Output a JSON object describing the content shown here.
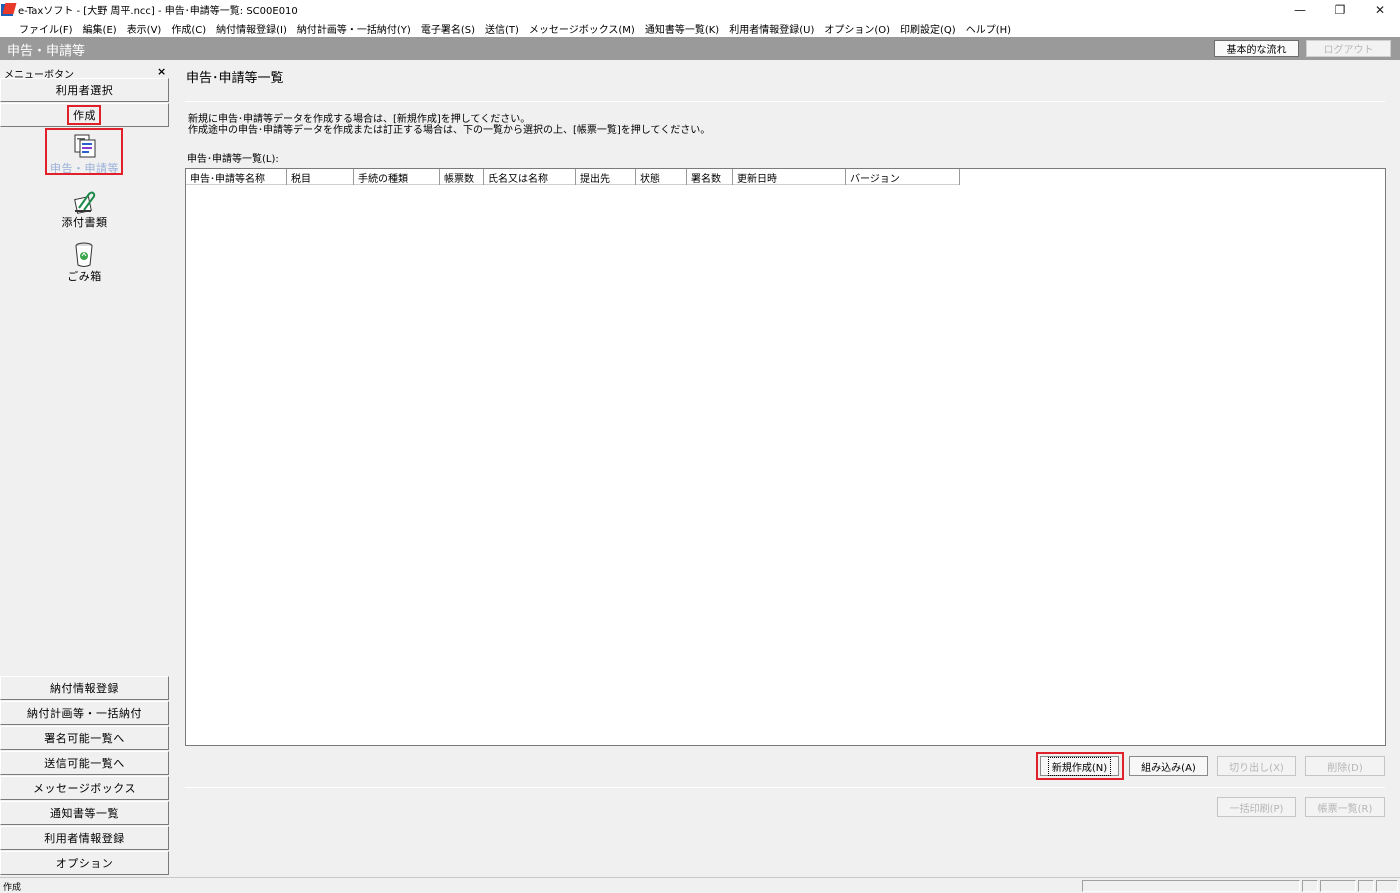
{
  "window": {
    "title": "e-Taxソフト - [大野 周平.ncc] - 申告･申請等一覧: SC00E010",
    "minimize": "—",
    "maximize": "❐",
    "close": "✕"
  },
  "menubar": [
    "ファイル(F)",
    "編集(E)",
    "表示(V)",
    "作成(C)",
    "納付情報登録(I)",
    "納付計画等・一括納付(Y)",
    "電子署名(S)",
    "送信(T)",
    "メッセージボックス(M)",
    "通知書等一覧(K)",
    "利用者情報登録(U)",
    "オプション(O)",
    "印刷設定(Q)",
    "ヘルプ(H)"
  ],
  "header": {
    "title": "申告・申請等",
    "basic_flow_button": "基本的な流れ",
    "logout_button": "ログアウト"
  },
  "left_menu": {
    "caption": "メニューボタン",
    "close": "×",
    "user_select": "利用者選択",
    "create": "作成",
    "sub_items": {
      "declaration": "申告・申請等",
      "attachments": "添付書類",
      "trash": "ごみ箱"
    },
    "bottom_buttons": [
      "納付情報登録",
      "納付計画等・一括納付",
      "署名可能一覧へ",
      "送信可能一覧へ",
      "メッセージボックス",
      "通知書等一覧",
      "利用者情報登録",
      "オプション"
    ]
  },
  "main": {
    "title": "申告･申請等一覧",
    "instruction_line1": "新規に申告･申請等データを作成する場合は、[新規作成]を押してください。",
    "instruction_line2": "作成途中の申告･申請等データを作成または訂正する場合は、下の一覧から選択の上、[帳票一覧]を押してください。",
    "list_label": "申告･申請等一覧(L):",
    "columns": [
      "申告･申請等名称",
      "税目",
      "手続の種類",
      "帳票数",
      "氏名又は名称",
      "提出先",
      "状態",
      "署名数",
      "更新日時",
      "バージョン"
    ],
    "rows": [],
    "buttons": {
      "new": "新規作成(N)",
      "import": "組み込み(A)",
      "export": "切り出し(X)",
      "delete": "削除(D)",
      "batch_print": "一括印刷(P)",
      "form_list": "帳票一覧(R)"
    }
  },
  "status_bar": {
    "text": "作成"
  }
}
